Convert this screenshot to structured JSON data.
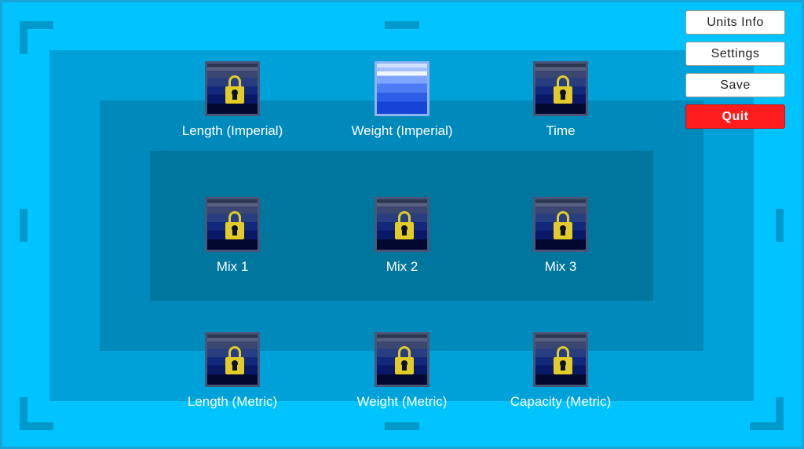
{
  "menu": {
    "units_info_label": "Units Info",
    "settings_label": "Settings",
    "save_label": "Save",
    "quit_label": "Quit"
  },
  "levels": [
    {
      "label": "Length (Imperial)",
      "locked": true
    },
    {
      "label": "Weight (Imperial)",
      "locked": false
    },
    {
      "label": "Time",
      "locked": true
    },
    {
      "label": "Mix 1",
      "locked": true
    },
    {
      "label": "Mix 2",
      "locked": true
    },
    {
      "label": "Mix 3",
      "locked": true
    },
    {
      "label": "Length (Metric)",
      "locked": true
    },
    {
      "label": "Weight (Metric)",
      "locked": true
    },
    {
      "label": "Capacity (Metric)",
      "locked": true
    }
  ],
  "colors": {
    "background": "#00c3ff",
    "quit": "#ff1c1c",
    "lock": "#e3cc28"
  },
  "icons": {
    "locked": "padlock-icon",
    "unlocked": "blue-gradient-tile"
  }
}
